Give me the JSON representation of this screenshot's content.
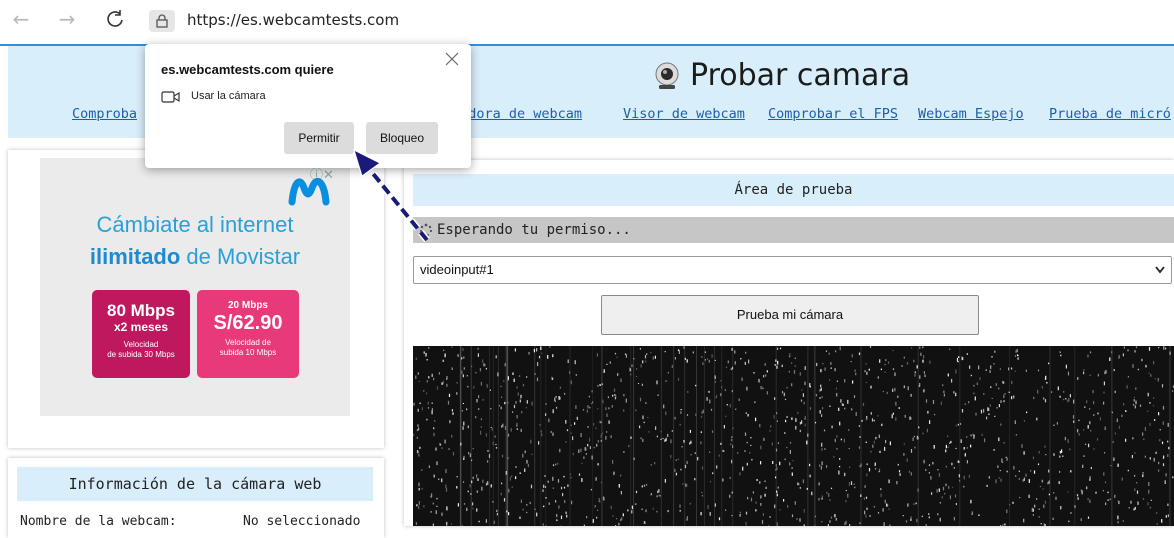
{
  "browser": {
    "url": "https://es.webcamtests.com",
    "back_glyph": "←",
    "forward_glyph": "→",
    "reload_glyph": "C",
    "lock_glyph": "🔒"
  },
  "site": {
    "title": "Probar camara",
    "nav": [
      "Comprobador de webcam",
      "Visor de webcam",
      "Comprobar el FPS",
      "Webcam Espejo",
      "Prueba de micrófono"
    ],
    "nav_visible_fragments": [
      "Comproba",
      "padora de webcam",
      "Visor de webcam",
      "Comprobar el FPS",
      "Webcam Espejo",
      "Prueba de micró"
    ]
  },
  "popup": {
    "title": "es.webcamtests.com quiere",
    "permission": "Usar la cámara",
    "allow_label": "Permitir",
    "block_label": "Bloqueo",
    "close_glyph": "╳"
  },
  "ad": {
    "adchoices_glyph": "ⓘ✕",
    "line1": "Cámbiate al internet",
    "line2_bold": "ilimitado",
    "line2_rest": " de Movistar",
    "offer1": {
      "speed": "80 Mbps",
      "period": "x2 meses",
      "note1": "Velocidad",
      "note2": "de subida 30 Mbps"
    },
    "offer2": {
      "top": "20 Mbps",
      "price": "S/62.90",
      "note1": "Velocidad de",
      "note2": "subida 10 Mbps"
    }
  },
  "info": {
    "heading": "Información de la cámara web",
    "row_label": "Nombre de la webcam:",
    "row_value": "No seleccionado"
  },
  "test": {
    "heading": "Área de prueba",
    "status": "Esperando tu permiso...",
    "device": "videoinput#1",
    "button": "Prueba mi cámara"
  },
  "colors": {
    "header_bg": "#d9eefb",
    "link": "#1d5fa8",
    "accent_line": "#2e90e0",
    "arrow": "#1a1a78"
  }
}
